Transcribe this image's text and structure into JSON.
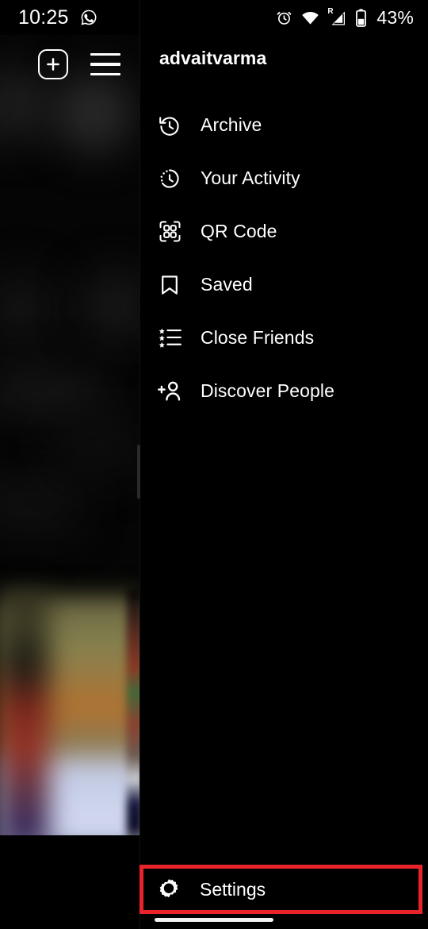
{
  "status_bar": {
    "time": "10:25",
    "whatsapp_icon": "whatsapp-icon",
    "alarm_icon": "alarm-clock-icon",
    "wifi_icon": "wifi-icon",
    "signal_icon": "cellular-signal-icon",
    "roaming_letter": "R",
    "battery_icon": "battery-icon",
    "battery_level": "43%"
  },
  "feed_header": {
    "add_post_icon": "plus-square-icon",
    "menu_icon": "hamburger-menu-icon"
  },
  "drawer": {
    "username": "advaitvarma",
    "items": [
      {
        "label": "Archive",
        "icon": "archive-clock-icon"
      },
      {
        "label": "Your Activity",
        "icon": "activity-clock-icon"
      },
      {
        "label": "QR Code",
        "icon": "qr-code-icon"
      },
      {
        "label": "Saved",
        "icon": "bookmark-icon"
      },
      {
        "label": "Close Friends",
        "icon": "star-list-icon"
      },
      {
        "label": "Discover People",
        "icon": "add-person-icon"
      }
    ],
    "settings": {
      "label": "Settings",
      "icon": "gear-icon",
      "highlight_color": "#e8232a"
    }
  },
  "system_nav": {
    "home_indicator": "home-indicator"
  },
  "colors": {
    "background": "#000000",
    "text": "#ffffff",
    "highlight": "#e8232a"
  }
}
